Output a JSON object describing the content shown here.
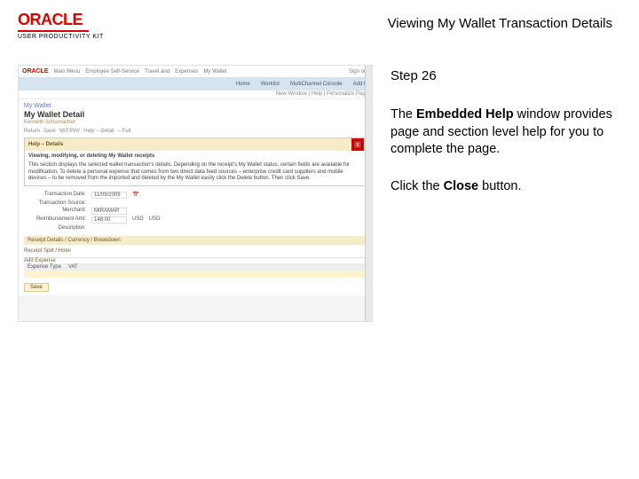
{
  "header": {
    "brand": "ORACLE",
    "subbrand": "USER PRODUCTIVITY KIT",
    "title": "Viewing My Wallet Transaction Details"
  },
  "screenshot": {
    "topnav": {
      "brand": "ORACLE",
      "items": [
        "Main Menu",
        "Employee Self-Service",
        "Travel and",
        "Expenses",
        "My Wallet"
      ],
      "signout": "Sign out"
    },
    "subnav": {
      "items": [
        "Home",
        "Worklist",
        "MultiChannel Console",
        "Add to"
      ]
    },
    "crumb": "New Window | Help | Personalize Page",
    "wallet": {
      "breadcrumb": "My Wallet",
      "title": "My Wallet Detail",
      "subtitle": "Kenneth Schumacher"
    },
    "commands": {
      "return": "Return",
      "save": "Save",
      "varpay": "VAT/PAY",
      "help": "Help – Detail",
      "full": "– Full"
    },
    "help_panel": {
      "title": "Help – Details",
      "close": "x",
      "heading": "Viewing, modifying, or deleting My Wallet receipts",
      "body": "This section displays the selected wallet transaction's details. Depending on the receipt's My Wallet status, certain fields are available for modification. To delete a personal expense that comes from two direct data feed sources – enterprise credit card suppliers and mobile devices – to be removed from the imported and deleted by the My Wallet easily click the Delete button. Then click Save."
    },
    "fields": {
      "date_label": "Transaction Date:",
      "date_value": "11/09/2009",
      "source_label": "Transaction Source:",
      "merchant_label": "Merchant:",
      "merchant_value": "MIRAMAR",
      "amount_label": "Reimbursement Amt:",
      "amount_value": "148.00",
      "currency": "USD",
      "usd": "USD",
      "desc_label": "Description:"
    },
    "receipt_bar": "Receipt Details / Currency / Breakdown",
    "link": "Receipt Split / Hotel",
    "table": {
      "cmd": "Add Expense",
      "col1": "Expense Type",
      "col2": "VAT"
    },
    "end_button": "Save"
  },
  "instructions": {
    "step": "Step 26",
    "p1_a": "The ",
    "p1_b": "Embedded Help",
    "p1_c": " window provides page and section level help for you to complete the page.",
    "p2_a": "Click the ",
    "p2_b": "Close",
    "p2_c": " button."
  }
}
